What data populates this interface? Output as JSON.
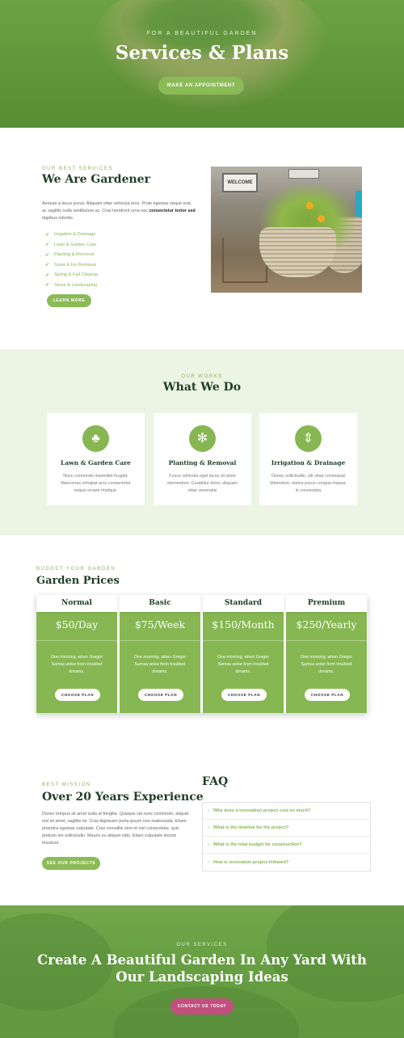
{
  "hero": {
    "subtitle": "FOR A BEAUTIFUL GARDEN",
    "title": "Services & Plans",
    "button": "MAKE AN APPOINTMENT"
  },
  "about": {
    "subtitle": "OUR BEST SERVICES",
    "title": "We Are Gardener",
    "text_plain": "Aenean a lacus purus. Aliquam vitae vehicula eros. Proin egestas neque erat, ac sagittis nulla vestibulum ac. Cras hendrerit urna nec ",
    "text_bold": "consectetur tortor sed",
    "text_end": " dapibus lobortis.",
    "checklist": [
      "Irrigation & Drainage",
      "Lawn & Garden Care",
      "Planting & Removal",
      "Snow & Ice Removal",
      "Spring & Fall Cleanup",
      "Stone & Landscaping"
    ],
    "button": "LEARN MORE",
    "photo_sign": "WELCOME"
  },
  "works": {
    "subtitle": "OUR WORKS",
    "title": "What We Do",
    "cards": [
      {
        "icon": "tree-icon",
        "glyph": "♣",
        "title": "Lawn & Garden Care",
        "text": "Nunc commodo imperdiet feugiat. Maecenas volutpat arcu consectetur neque ornare tristique."
      },
      {
        "icon": "flower-icon",
        "glyph": "✻",
        "title": "Planting & Removal",
        "text": "Fusce vehicula eget lacus sit amet elementum. Curabitur dolor, aliquam vitae venenatis"
      },
      {
        "icon": "drainage-icon",
        "glyph": "⇕",
        "title": "Irrigation & Drainage",
        "text": "Donec sollicitudin, elit vitae consequat bibendum, metus purus congue massa, in consectetu"
      }
    ]
  },
  "prices": {
    "subtitle": "BUDGET YOUR GARDEN",
    "title": "Garden Prices",
    "plans": [
      {
        "name": "Normal",
        "price": "$50/Day",
        "desc": "One morning, when Gregor Samsa woke from troubled dreams.",
        "button": "CHOOSE PLAN"
      },
      {
        "name": "Basic",
        "price": "$75/Week",
        "desc": "One morning, when Gregor Samsa woke from troubled dreams.",
        "button": "CHOOSE PLAN"
      },
      {
        "name": "Standard",
        "price": "$150/Month",
        "desc": "One morning, when Gregor Samsa woke from troubled dreams.",
        "button": "CHOOSE PLAN"
      },
      {
        "name": "Premium",
        "price": "$250/Yearly",
        "desc": "One morning, when Gregor Samsa woke from troubled dreams.",
        "button": "CHOOSE PLAN"
      }
    ]
  },
  "mission": {
    "subtitle": "BEST MISSION",
    "title": "Over 20 Years Experience",
    "text": "Donec tempus sit amet nulla at fringilla. Quisque vel nunc commodo, aliquet nisl sit amet, sagittis mi. Cras dignissim porta ipsum non malesuada. Etiam pharetra egestas vulputate. Cras convallis sem et nisl consectetur, quis pretium leo sollicitudin. Mauris eu aliquet odio. Etiam vulputate dictum tincidunt.",
    "button": "SEE OUR PROJECTS"
  },
  "faq": {
    "title": "FAQ",
    "items": [
      "Why does a renovation project cost so much?",
      "What is the timeline for the project?",
      "What is the total budget for construction?",
      "How is renovation project initiated?"
    ]
  },
  "cta": {
    "subtitle": "OUR SERVICES",
    "title": "Create A Beautiful Garden In Any Yard With Our Landscaping Ideas",
    "button": "CONTACT US TODAY"
  },
  "colors": {
    "accent_green": "#86b752",
    "dark_green": "#1f3d26",
    "cta_pink": "#c2507e",
    "section_tint": "#ecf4e4"
  }
}
